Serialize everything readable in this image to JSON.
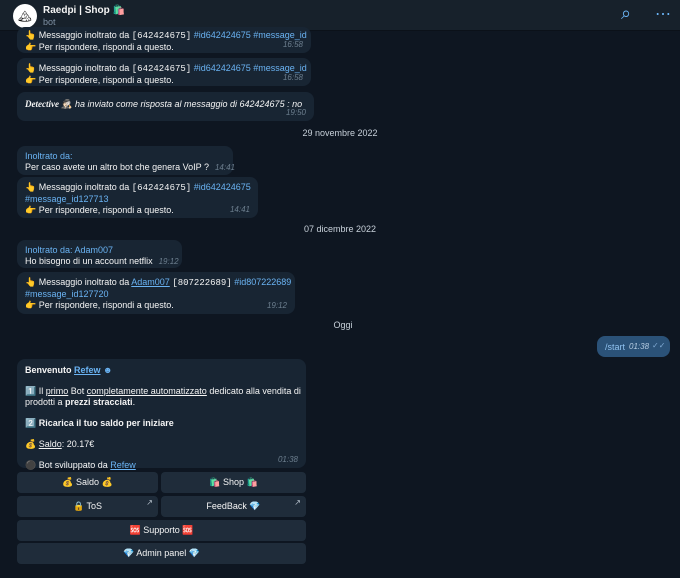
{
  "header": {
    "avatar_glyph": "🏔",
    "title": "Raedpi | Shop 🛍️",
    "subtitle": "bot",
    "search_icon": "⌕",
    "more_icon": "⋯"
  },
  "messages": {
    "m1": {
      "l1a": "👆 Messaggio inoltrato da ",
      "l1b": "[642424675]",
      "l1c": "#id642424675",
      "l1d": "#message_id",
      "l2": "👉 Per rispondere, rispondi a questo.",
      "time": "16:58"
    },
    "m2": {
      "l1a": "👆 Messaggio inoltrato da ",
      "l1b": "[642424675]",
      "l1c": "#id642424675",
      "l1d": "#message_id",
      "l2": "👉 Per rispondere, rispondi a questo.",
      "time": "16:58"
    },
    "m3": {
      "name": "Detective 🕵🏻",
      "text": " ha inviato come risposta al messaggio di 642424675 : no",
      "time": "19:50"
    },
    "date1": "29 novembre 2022",
    "m4": {
      "fwd": "Inoltrato da:",
      "text": "Per caso avete un altro bot che genera VoIP ?",
      "time": "14:41"
    },
    "m5": {
      "l1a": "👆 Messaggio inoltrato da ",
      "l1b": "[642424675]",
      "l1c": "#id642424675",
      "l1d": "#message_id127713",
      "l2": "👉 Per rispondere, rispondi a questo.",
      "time": "14:41"
    },
    "date2": "07 dicembre 2022",
    "m6": {
      "fwd": "Inoltrato da: Adam007",
      "text": "Ho bisogno di un account netflix",
      "time": "19:12"
    },
    "m7": {
      "l1a": "👆 Messaggio inoltrato da ",
      "l1b": "Adam007",
      "l1c": "[807222689]",
      "l1d": "#id807222689",
      "l1e": "#message_id127720",
      "l2": "👉 Per rispondere, rispondi a questo.",
      "time": "19:12"
    },
    "date3": "Oggi",
    "out": {
      "text": "/start",
      "time": "01:38",
      "check": "✓✓"
    },
    "bot": {
      "welcome_a": "Benvenuto ",
      "welcome_b": "Refew",
      "welcome_c": " ☻",
      "p1a": "1️⃣ Il ",
      "p1b": "primo",
      "p1c": " Bot ",
      "p1d": "completamente automatizzato",
      "p1e": " dedicato alla vendita di",
      "p1f": "prodotti a ",
      "p1g": "prezzi stracciati",
      "p1h": ".",
      "p2": "2️⃣ Ricarica il tuo saldo per iniziare",
      "p3a": "💰 ",
      "p3b": "Saldo",
      "p3c": ": 20.17€",
      "p4a": "⚫ Bot sviluppato da ",
      "p4b": "Refew",
      "time": "01:38"
    }
  },
  "keyboard": {
    "saldo": "💰 Saldo 💰",
    "shop": "🛍️ Shop 🛍️",
    "tos": "🔒 ToS",
    "feedback": "FeedBack 💎",
    "supporto": "🆘 Supporto 🆘",
    "admin": "💎 Admin panel 💎",
    "arrow": "↗"
  }
}
